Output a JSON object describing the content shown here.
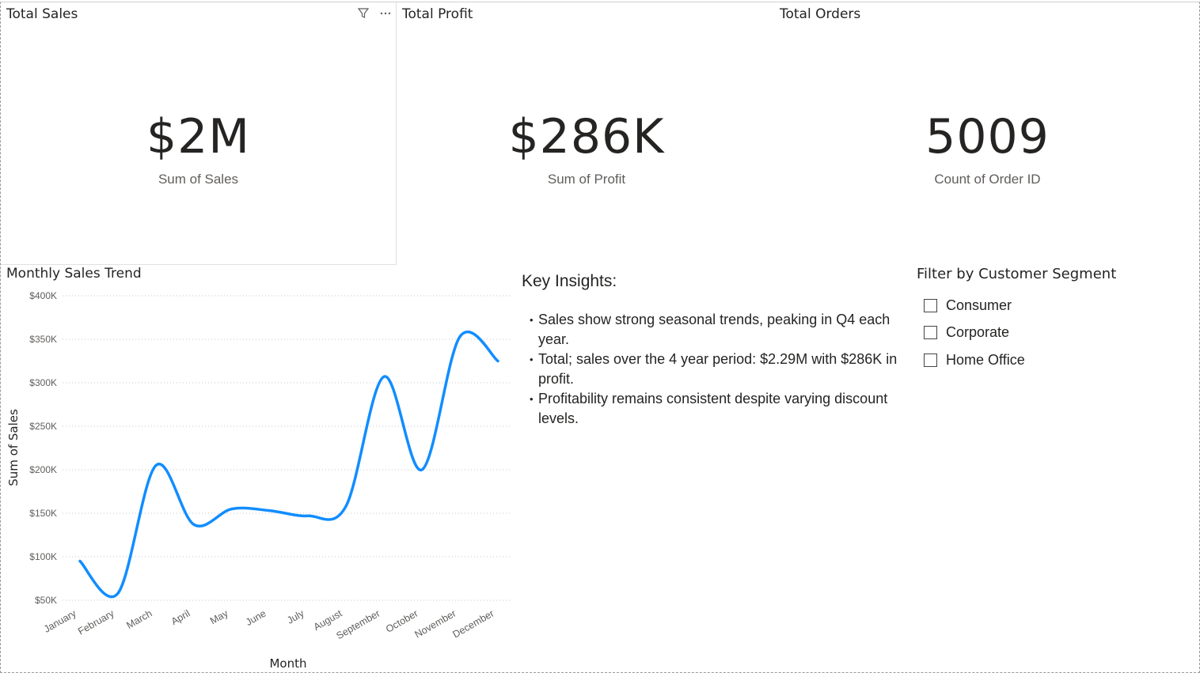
{
  "cards": [
    {
      "id": "sales",
      "title": "Total Sales",
      "value": "$2M",
      "label": "Sum of Sales"
    },
    {
      "id": "profit",
      "title": "Total Profit",
      "value": "$286K",
      "label": "Sum of Profit"
    },
    {
      "id": "orders",
      "title": "Total Orders",
      "value": "5009",
      "label": "Count of Order ID"
    }
  ],
  "card_icons": {
    "filter": "filter-icon",
    "more": "more-options-icon"
  },
  "chart": {
    "title": "Monthly Sales Trend"
  },
  "chart_data": {
    "type": "line",
    "title": "Monthly Sales Trend",
    "xlabel": "Month",
    "ylabel": "Sum of Sales",
    "categories": [
      "January",
      "February",
      "March",
      "April",
      "May",
      "June",
      "July",
      "August",
      "September",
      "October",
      "November",
      "December"
    ],
    "series": [
      {
        "values": [
          95000,
          58000,
          205000,
          137000,
          155000,
          153000,
          147000,
          158000,
          307000,
          200000,
          353000,
          325000
        ]
      }
    ],
    "yticks": [
      "$50K",
      "$100K",
      "$150K",
      "$200K",
      "$250K",
      "$300K",
      "$350K",
      "$400K"
    ],
    "ylim": [
      50000,
      400000
    ],
    "grid": true,
    "line_color": "#118DFF"
  },
  "insights": {
    "title": "Key Insights:",
    "items": [
      "Sales show strong seasonal trends, peaking in Q4 each year.",
      "Total; sales over the 4 year period: $2.29M with $286K in profit.",
      "Profitability remains consistent despite varying discount levels."
    ]
  },
  "slicer": {
    "title": "Filter by Customer Segment",
    "options": [
      "Consumer",
      "Corporate",
      "Home Office"
    ]
  }
}
